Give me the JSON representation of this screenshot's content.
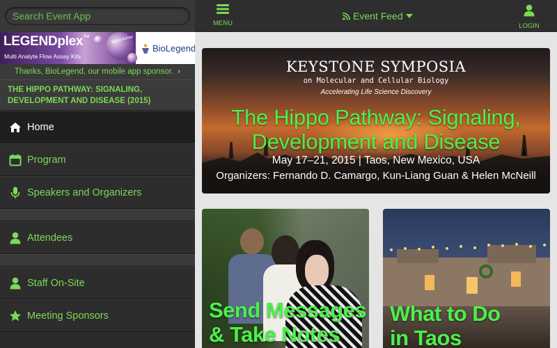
{
  "colors": {
    "accent": "#7cd957",
    "hero_title": "#4cf04a"
  },
  "search": {
    "placeholder": "Search Event App"
  },
  "sponsor": {
    "banner_title": "LEGENDplex",
    "banner_title_mark": "™",
    "banner_subtitle": "Multi Analyte Flow Assay Kits",
    "bead_text": "Bead Assay",
    "company": "BioLegend",
    "thanks": "Thanks, BioLegend, our mobile app sponsor.",
    "thanks_icon": "chevron-right-icon"
  },
  "event_title": "THE HIPPO PATHWAY: SIGNALING, DEVELOPMENT AND DISEASE (2015)",
  "nav": {
    "items": [
      {
        "label": "Home",
        "icon": "home-icon",
        "active": true
      },
      {
        "label": "Program",
        "icon": "calendar-icon"
      },
      {
        "label": "Speakers and Organizers",
        "icon": "microphone-icon"
      },
      {
        "label": "Attendees",
        "icon": "user-icon"
      },
      {
        "label": "Staff On-Site",
        "icon": "user-icon"
      },
      {
        "label": "Meeting Sponsors",
        "icon": "star-icon"
      }
    ]
  },
  "topbar": {
    "menu_label": "MENU",
    "feed_label": "Event Feed",
    "login_label": "LOGIN"
  },
  "hero": {
    "org": "KEYSTONE SYMPOSIA",
    "org_sub": "on Molecular and Cellular Biology",
    "tagline": "Accelerating Life Science Discovery",
    "title_line1": "The Hippo Pathway: Signaling,",
    "title_line2": "Development and Disease",
    "date": "May 17–21, 2015 | Taos, New Mexico, USA",
    "organizers": "Organizers: Fernando D. Camargo, Kun-Liang Guan & Helen McNeill"
  },
  "cards": [
    {
      "line1": "Send Messages",
      "line2": "& Take Notes"
    },
    {
      "line1": "What to Do",
      "line2": "in Taos"
    }
  ]
}
